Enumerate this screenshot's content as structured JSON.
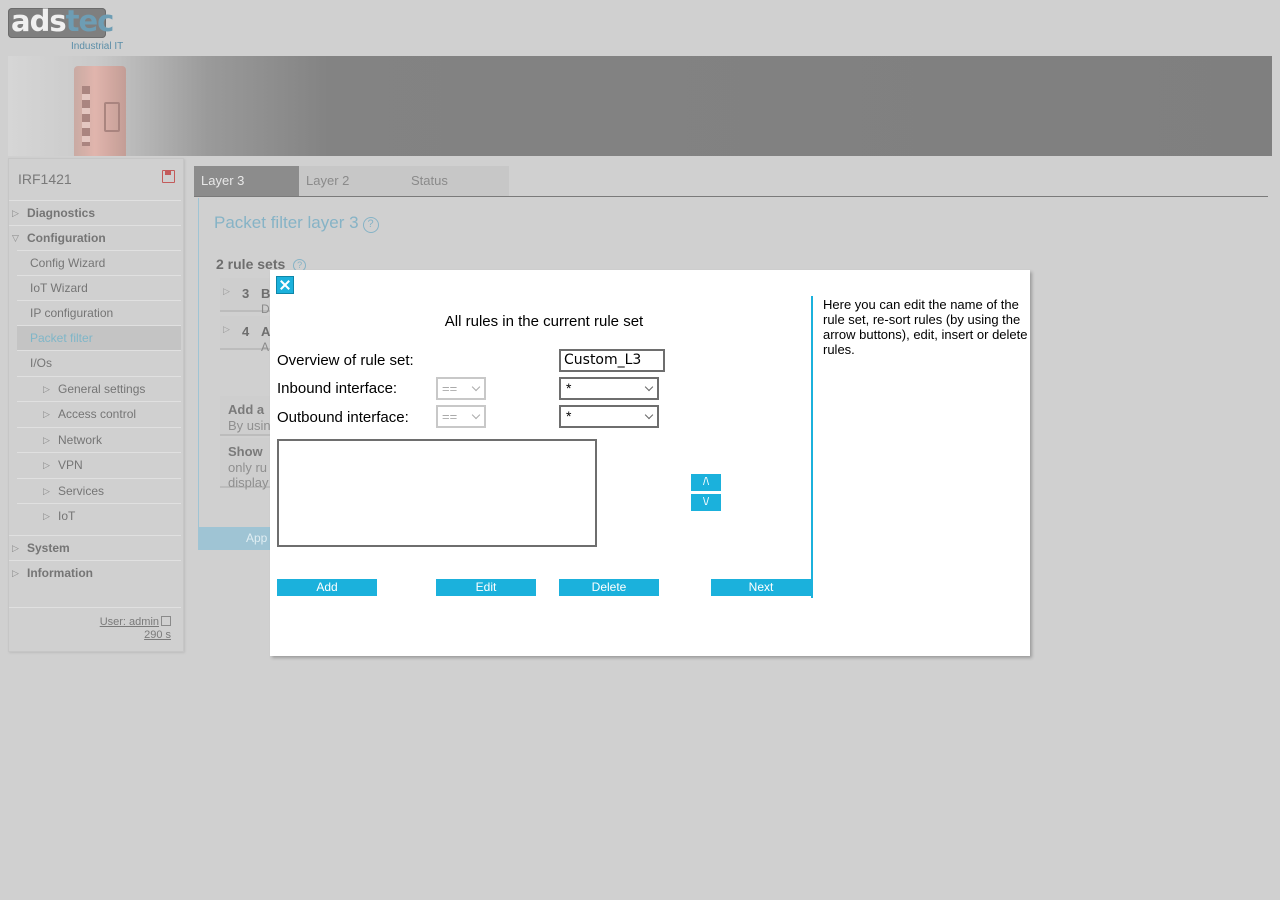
{
  "logo": {
    "text_a": "ads",
    "text_b": "tec",
    "subtitle": "Industrial IT"
  },
  "sidebar": {
    "device_name": "IRF1421",
    "items": [
      {
        "label": "Diagnostics"
      },
      {
        "label": "Configuration"
      },
      {
        "label": "Config Wizard"
      },
      {
        "label": "IoT Wizard"
      },
      {
        "label": "IP configuration"
      },
      {
        "label": "Packet filter"
      },
      {
        "label": "I/Os"
      },
      {
        "label": "General settings"
      },
      {
        "label": "Access control"
      },
      {
        "label": "Network"
      },
      {
        "label": "VPN"
      },
      {
        "label": "Services"
      },
      {
        "label": "IoT"
      },
      {
        "label": "System"
      },
      {
        "label": "Information"
      }
    ],
    "user_label": "User: admin",
    "timer": "290 s"
  },
  "tabs": [
    {
      "label": "Layer 3",
      "active": true
    },
    {
      "label": "Layer 2",
      "active": false
    },
    {
      "label": "Status",
      "active": false
    }
  ],
  "content": {
    "title": "Packet filter layer 3",
    "help_glyph": "?",
    "rule_sets_heading": "2 rule sets",
    "background_sets": [
      {
        "number": "3",
        "letter": "B",
        "sub": "D"
      },
      {
        "number": "4",
        "letter": "A",
        "sub": "A"
      }
    ],
    "options": [
      {
        "title": "Add a",
        "desc_lines": [
          "By usin"
        ]
      },
      {
        "title": "Show",
        "desc_lines": [
          "only ru",
          "display"
        ]
      }
    ],
    "apply_label": "App"
  },
  "modal": {
    "heading": "All rules in the current rule set",
    "overview_label": "Overview of rule set:",
    "rule_set_name": "Custom_L3",
    "inbound_label": "Inbound interface:",
    "inbound_operator": "==",
    "inbound_value": "*",
    "outbound_label": "Outbound interface:",
    "outbound_operator": "==",
    "outbound_value": "*",
    "move_up_label": "/\\",
    "move_down_label": "\\/",
    "buttons": {
      "add": "Add",
      "edit": "Edit",
      "delete": "Delete",
      "next": "Next"
    },
    "help_text": "Here you can edit the name of the rule set, re-sort rules (by using the arrow buttons), edit, insert or delete rules."
  },
  "colors": {
    "accent": "#1bb1dc",
    "muted_accent": "#86b3c6",
    "background": "#d0d0d0"
  }
}
